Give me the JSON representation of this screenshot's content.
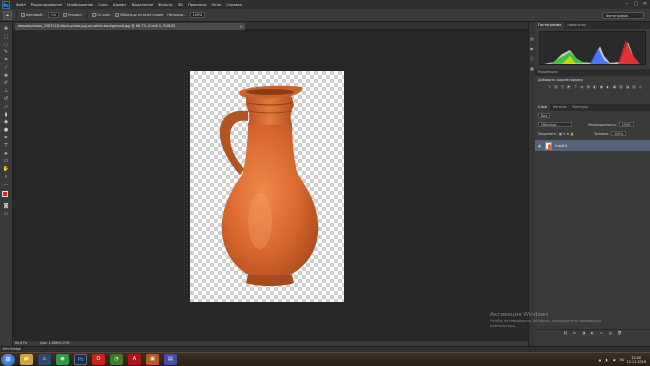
{
  "menubar": {
    "logo": "Ps",
    "items": [
      "Файл",
      "Редактирование",
      "Изображение",
      "Слои",
      "Шрифт",
      "Выделение",
      "Фильтр",
      "3D",
      "Просмотр",
      "Окно",
      "Справка"
    ],
    "controls": [
      "–",
      "▢",
      "✕"
    ]
  },
  "options": {
    "tool_icon": "⌖",
    "autoselect_label": "Автовыб.:",
    "autoselect_value": "Сл",
    "transform_label": "Управл.",
    "layer_label": "Сл.ком.",
    "align_label": "Образцы со всех слоев",
    "opacity_label": "Непрозр.:",
    "opacity_value": "100%",
    "workspace": "Фотография"
  },
  "document": {
    "tab_title": "depositphotos_2085118-stock-photo-jug-on-white-background.jpg @ 66,7% (Слой 0, RGB/8)",
    "tab_close": "×"
  },
  "status": {
    "zoom": "66,67%",
    "doc_info": "Док: 2,88М/2,07М"
  },
  "minibridge": {
    "label": "Mini Bridge"
  },
  "panels": {
    "top_tabs": [
      "Гистограмма",
      "Навигатор"
    ],
    "adjust_tab": "Коррекция",
    "adjust_title": "Добавить корректировку",
    "adjust_icons": [
      "☼",
      "▥",
      "◫",
      "◩",
      "▽",
      "◍",
      "▤",
      "◧",
      "▦",
      "◐",
      "▣",
      "▧",
      "◪",
      "▨",
      "◎"
    ],
    "layer_tabs": [
      "Слои",
      "Каналы",
      "Контуры"
    ],
    "filter_label": "Вид",
    "blend_mode": "Обычные",
    "opacity_label": "Непрозрачность:",
    "opacity_value": "100%",
    "lock_label": "Закрепить:",
    "fill_label": "Заливка:",
    "fill_value": "100%",
    "layer_name": "Слой 0",
    "layer_eye": "◉",
    "bottom_icons": [
      "⛓",
      "fx",
      "◨",
      "◐",
      "▭",
      "▤",
      "🗑"
    ]
  },
  "activation": {
    "title": "Активация Windows",
    "text": "Чтобы активировать Windows, перейдите в параметры компьютера."
  },
  "taskbar": {
    "apps": [
      {
        "icon": "📁",
        "color": "#c9a24a"
      },
      {
        "icon": "♨",
        "color": "#2b4a6d"
      },
      {
        "icon": "◉",
        "color": "#2b9a4a"
      },
      {
        "icon": "Ps",
        "color": "#1c2d44"
      },
      {
        "icon": "O",
        "color": "#c7261e"
      },
      {
        "icon": "◔",
        "color": "#3a7d2b"
      },
      {
        "icon": "A",
        "color": "#b3121b"
      },
      {
        "icon": "▣",
        "color": "#b85b1e"
      },
      {
        "icon": "▤",
        "color": "#4a4aa8"
      }
    ],
    "lang": "RU",
    "time": "12:00",
    "date": "12.11.2019"
  },
  "colors": {
    "foreground": "#e02424",
    "background": "#ffffff",
    "jug": "#d4652c"
  }
}
